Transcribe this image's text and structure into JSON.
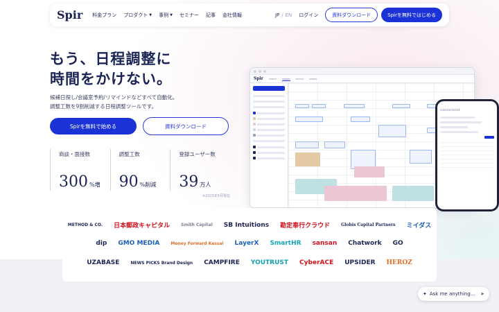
{
  "header": {
    "logo": "Spir",
    "nav": [
      {
        "label": "料金プラン",
        "dropdown": false
      },
      {
        "label": "プロダクト",
        "dropdown": true
      },
      {
        "label": "事例",
        "dropdown": true
      },
      {
        "label": "セミナー",
        "dropdown": false
      },
      {
        "label": "記事",
        "dropdown": false
      },
      {
        "label": "会社情報",
        "dropdown": false
      }
    ],
    "lang_jp": "JP",
    "lang_sep": "/",
    "lang_en": "EN",
    "login": "ログイン",
    "download_label": "資料ダウンロード",
    "start_label": "Spirを無料ではじめる"
  },
  "hero": {
    "title_line1": "もう、日程調整に",
    "title_line2": "時間をかけない。",
    "sub_line1": "候補日探し/会議室予約/リマインドなどすべて自動化。",
    "sub_line2": "調整工数を9割削減する日程調整ツールです。",
    "cta_primary": "Spirを無料で始める",
    "cta_secondary": "資料ダウンロード"
  },
  "stats": [
    {
      "label": "商談・面接数",
      "value": "300",
      "unit": "%増"
    },
    {
      "label": "調整工数",
      "value": "90",
      "unit": "%削減"
    },
    {
      "label": "登録ユーザー数",
      "value": "39",
      "unit": "万人"
    }
  ],
  "stats_note": "※2025年6月現在",
  "logos": {
    "row1": [
      "METHOD & CO.",
      "日本郵政キャピタル",
      "Smith Capital",
      "SB Intuitions",
      "勘定奉行クラウド",
      "Globis Capital Partners",
      "ミイダス"
    ],
    "row2": [
      "dip",
      "GMO MEDIA",
      "Money Forward Kessai",
      "LayerX",
      "SmartHR",
      "sansan",
      "Chatwork",
      "GO"
    ],
    "row3": [
      "UZABASE",
      "NEWS PICKS Brand Design",
      "CAMPFIRE",
      "YOUTRUST",
      "CyberACE",
      "UPSIDER",
      "HEROZ"
    ]
  },
  "ask": {
    "label": "Ask me anything...",
    "icon": "sparkle-icon",
    "send_icon": "send-icon"
  },
  "colors": {
    "primary": "#1b33d6",
    "navy": "#1b2555"
  }
}
